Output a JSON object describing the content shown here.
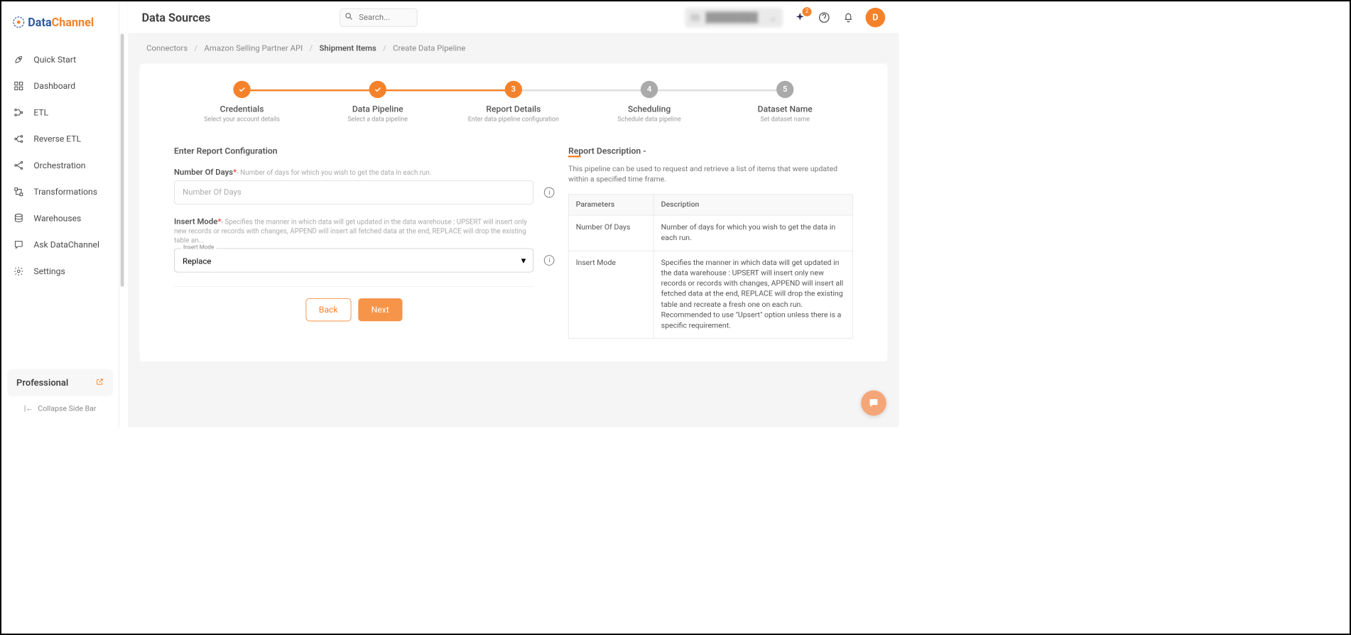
{
  "brand": {
    "part1": "Data",
    "part2": "Channel"
  },
  "sidebar": {
    "items": [
      {
        "label": "Quick Start"
      },
      {
        "label": "Dashboard"
      },
      {
        "label": "ETL"
      },
      {
        "label": "Reverse ETL"
      },
      {
        "label": "Orchestration"
      },
      {
        "label": "Transformations"
      },
      {
        "label": "Warehouses"
      },
      {
        "label": "Ask DataChannel"
      },
      {
        "label": "Settings"
      }
    ],
    "plan": "Professional",
    "collapse": "Collapse Side Bar"
  },
  "header": {
    "title": "Data Sources",
    "search_placeholder": "Search...",
    "badge_count": "2",
    "avatar_initial": "D"
  },
  "breadcrumb": {
    "items": [
      "Connectors",
      "Amazon Selling Partner API",
      "Shipment Items",
      "Create Data Pipeline"
    ],
    "current_index": 2
  },
  "stepper": [
    {
      "title": "Credentials",
      "sub": "Select your account details",
      "state": "done",
      "icon": "check"
    },
    {
      "title": "Data Pipeline",
      "sub": "Select a data pipeline",
      "state": "done",
      "icon": "check"
    },
    {
      "title": "Report Details",
      "sub": "Enter data pipeline configuration",
      "state": "active",
      "icon": "3"
    },
    {
      "title": "Scheduling",
      "sub": "Schedule data pipeline",
      "state": "pending",
      "icon": "4"
    },
    {
      "title": "Dataset Name",
      "sub": "Set dataset name",
      "state": "pending",
      "icon": "5"
    }
  ],
  "form": {
    "section_heading": "Enter Report Configuration",
    "fields": {
      "days": {
        "label": "Number Of Days",
        "hint": "- Number of days for which you wish to get the data in each run.",
        "placeholder": "Number Of Days"
      },
      "insert": {
        "label": "Insert Mode",
        "hint": "- Specifies the manner in which data will get updated in the data warehouse : UPSERT will insert only new records or records with changes, APPEND will insert all fetched data at the end, REPLACE will drop the existing table an...",
        "small_label": "Insert Mode",
        "value": "Replace"
      }
    },
    "back": "Back",
    "next": "Next"
  },
  "report": {
    "heading": "Report Description -",
    "desc": "This pipeline can be used to request and retrieve a list of items that were updated within a specified time frame.",
    "table": {
      "headers": [
        "Parameters",
        "Description"
      ],
      "rows": [
        [
          "Number Of Days",
          "Number of days for which you wish to get the data in each run."
        ],
        [
          "Insert Mode",
          "Specifies the manner in which data will get updated in the data warehouse : UPSERT will insert only new records or records with changes, APPEND will insert all fetched data at the end, REPLACE will drop the existing table and recreate a fresh one on each run. Recommended to use \"Upsert\" option unless there is a specific requirement."
        ]
      ]
    }
  }
}
